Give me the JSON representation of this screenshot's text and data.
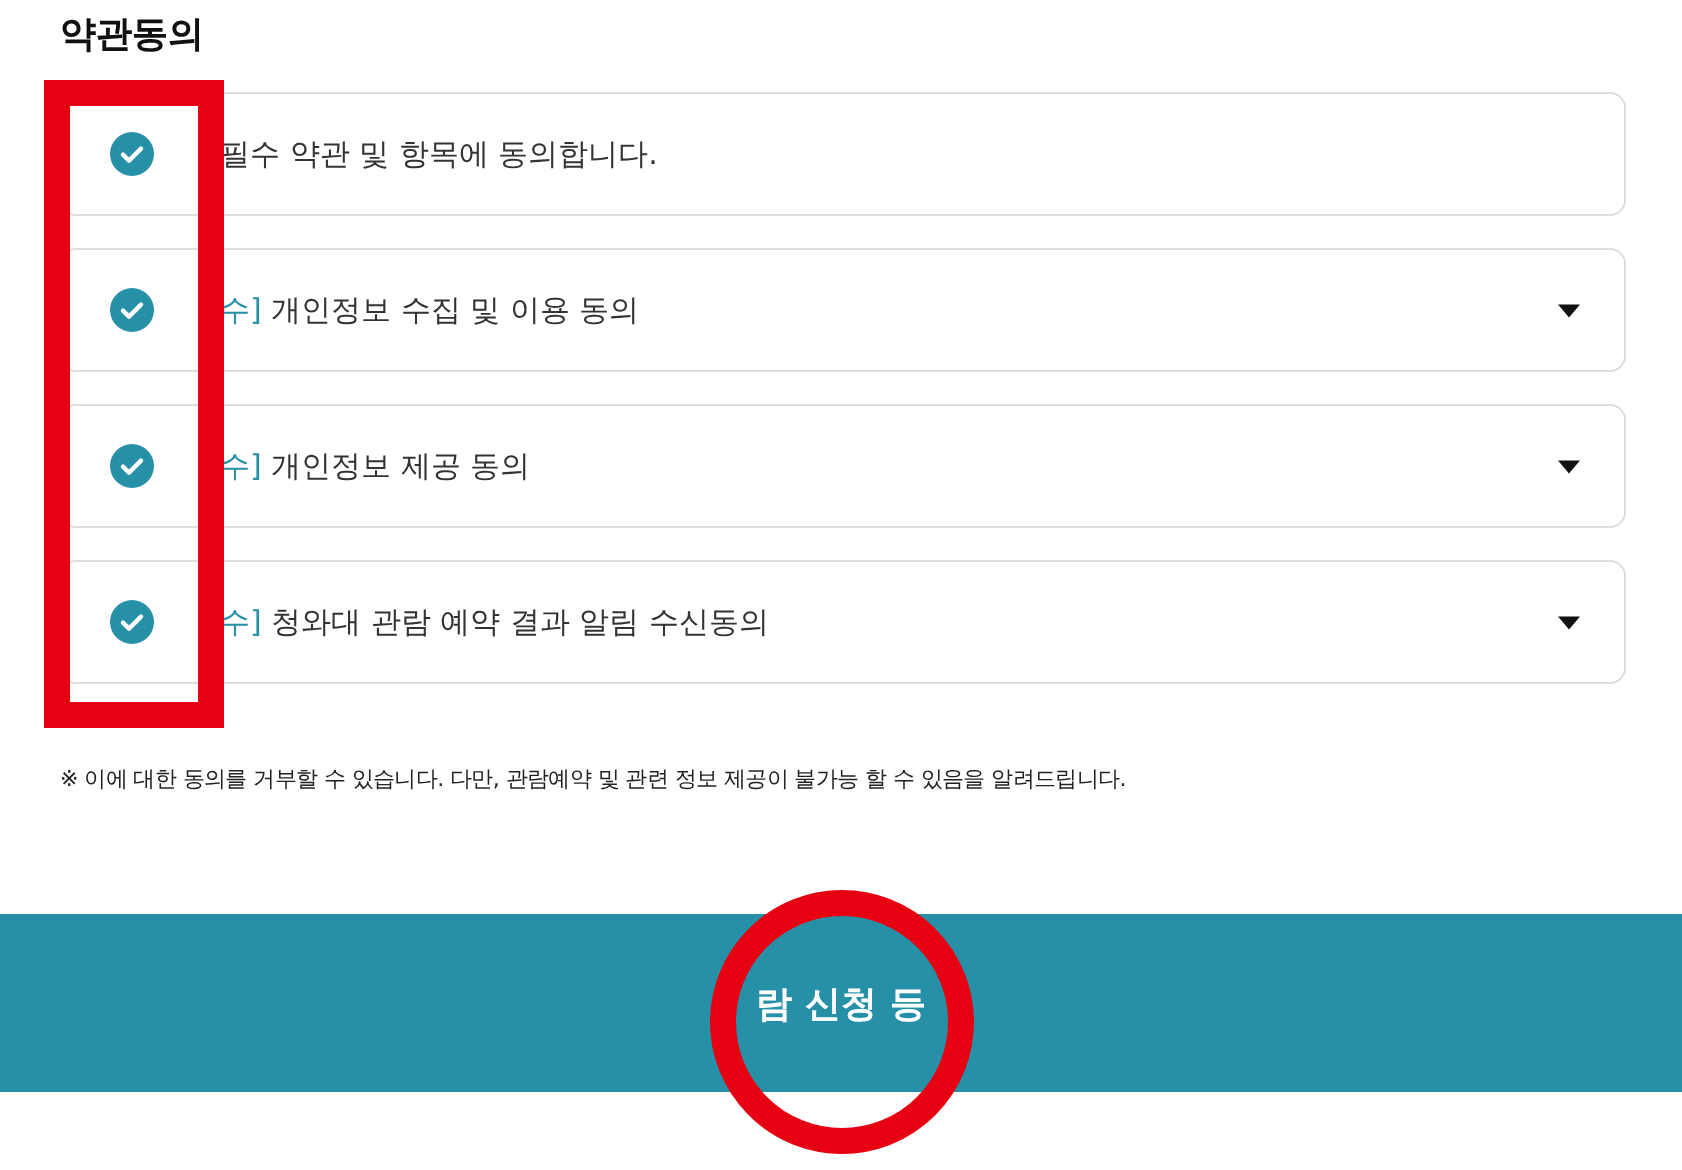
{
  "title": "약관동의",
  "terms": [
    {
      "checked": true,
      "label": "필수 약관 및 항목에 동의합니다.",
      "expandable": false
    },
    {
      "checked": true,
      "tag": "수]",
      "label": "개인정보 수집 및 이용 동의",
      "expandable": true
    },
    {
      "checked": true,
      "tag": "수]",
      "label": "개인정보 제공 동의",
      "expandable": true
    },
    {
      "checked": true,
      "tag": "수]",
      "label": "청와대 관람 예약 결과 알림 수신동의",
      "expandable": true
    }
  ],
  "notice": "※ 이에 대한 동의를 거부할 수 있습니다. 다만, 관람예약 및 관련 정보 제공이 불가능 할 수 있음을 알려드립니다.",
  "submit_button": "람 신청 등",
  "annotations": [
    {
      "kind": "rectangle"
    },
    {
      "kind": "circle"
    }
  ]
}
